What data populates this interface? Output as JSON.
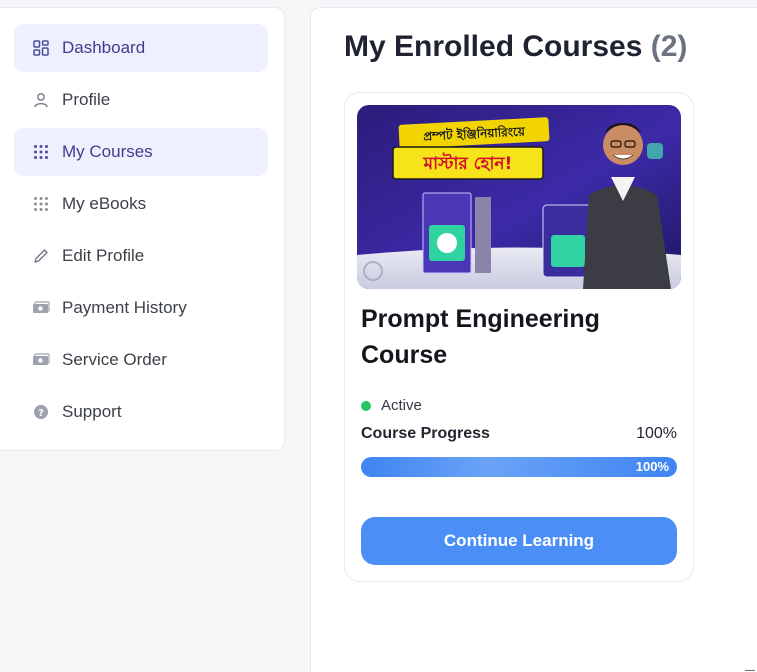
{
  "sidebar": {
    "items": [
      {
        "label": "Dashboard",
        "icon": "grid-icon",
        "active": true
      },
      {
        "label": "Profile",
        "icon": "user-icon",
        "active": false
      },
      {
        "label": "My Courses",
        "icon": "dots-grid-icon",
        "active": true
      },
      {
        "label": "My eBooks",
        "icon": "dots-grid-icon",
        "active": false
      },
      {
        "label": "Edit Profile",
        "icon": "pencil-icon",
        "active": false
      },
      {
        "label": "Payment History",
        "icon": "cash-icon",
        "active": false
      },
      {
        "label": "Service Order",
        "icon": "cash-icon",
        "active": false
      },
      {
        "label": "Support",
        "icon": "help-icon",
        "active": false
      }
    ]
  },
  "main": {
    "title": "My Enrolled Courses",
    "count": "(2)"
  },
  "course": {
    "thumbnail": {
      "headline_top": "প্রম্পট ইঞ্জিনিয়ারিংয়ে",
      "headline_bottom": "মাস্টার হোন!"
    },
    "title": "Prompt Engineering Course",
    "status": "Active",
    "progress_label": "Course Progress",
    "progress_value": "100%",
    "progress_fraction": 1.0,
    "bar_text": "100%",
    "cta": "Continue Learning"
  },
  "colors": {
    "accent": "#4a8ef6",
    "active_bg": "#eef0fd",
    "status_green": "#22c55e"
  }
}
